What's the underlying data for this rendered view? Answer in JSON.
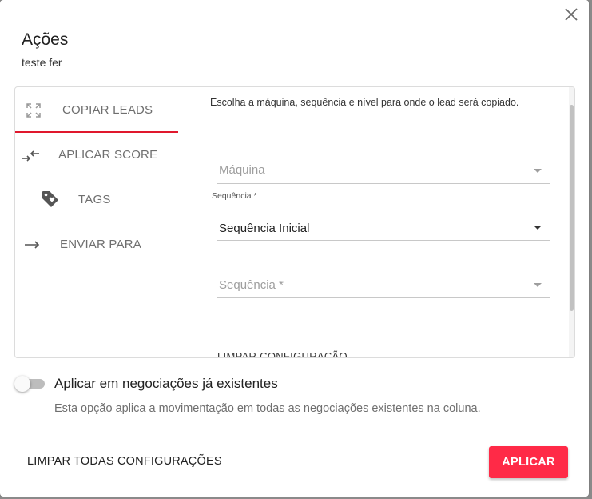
{
  "dialog": {
    "title": "Ações",
    "subtitle": "teste fer",
    "close_icon": "close-icon"
  },
  "tabs": [
    {
      "label": "COPIAR LEADS",
      "icon": "expand-arrows-icon",
      "active": true
    },
    {
      "label": "APLICAR SCORE",
      "icon": "swap-arrows-icon",
      "active": false
    },
    {
      "label": "TAGS",
      "icon": "tag-icon",
      "active": false
    },
    {
      "label": "ENVIAR PARA",
      "icon": "arrow-right-icon",
      "active": false
    }
  ],
  "copy_leads": {
    "instruction": "Escolha a máquina, sequência e nível para onde o lead será copiado.",
    "machine_placeholder": "Máquina",
    "sequence_label": "Sequência *",
    "sequence_value": "Sequência Inicial",
    "sequence2_placeholder": "Sequência *",
    "clear_config": "LIMPAR CONFIGURAÇÃO"
  },
  "toggle": {
    "label": "Aplicar em negociações já existentes",
    "description": "Esta opção aplica a movimentação em todas as negociações existentes na coluna.",
    "on": false
  },
  "footer": {
    "clear_all_label": "LIMPAR TODAS CONFIGURAÇÕES",
    "apply_label": "APLICAR"
  },
  "colors": {
    "accent": "#e0182d",
    "apply_button": "#ff2a47"
  }
}
